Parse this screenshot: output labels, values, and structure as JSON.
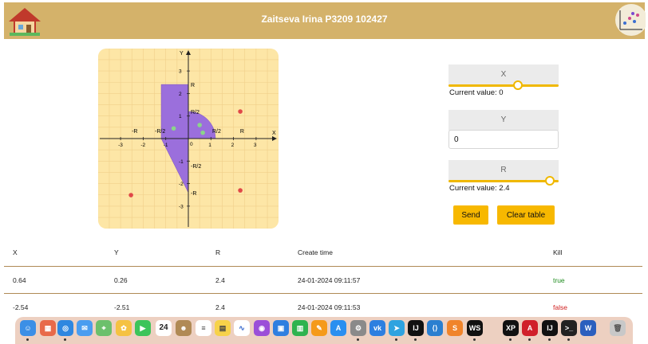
{
  "header": {
    "title": "Zaitseva Irina P3209 102427"
  },
  "graph": {
    "axis_x_label": "X",
    "axis_y_label": "Y",
    "x_ticks": [
      "-3",
      "-2",
      "-1",
      "0",
      "1",
      "2",
      "3"
    ],
    "y_ticks": [
      "3",
      "2",
      "1",
      "-1",
      "-2",
      "-3"
    ],
    "r_labels": {
      "r": "R",
      "half_r": "R/2",
      "neg_half_r": "-R/2",
      "neg_r": "-R"
    },
    "points": [
      {
        "x": 2.3,
        "y": 1.2,
        "hit": false
      },
      {
        "x": 0.5,
        "y": 0.6,
        "hit": true
      },
      {
        "x": -0.65,
        "y": 0.45,
        "hit": true
      },
      {
        "x": 0.64,
        "y": 0.26,
        "hit": true
      },
      {
        "x": -2.54,
        "y": -2.51,
        "hit": false
      },
      {
        "x": 2.3,
        "y": -2.3,
        "hit": false
      }
    ],
    "colors": {
      "area": "#9b6fdc",
      "hit": "#8bd48b",
      "miss": "#e04848",
      "background": "#fde6a6"
    }
  },
  "controls": {
    "x": {
      "label": "X",
      "current_label": "Current value: 0",
      "fraction": 0.63
    },
    "y": {
      "label": "Y",
      "value": "0"
    },
    "r": {
      "label": "R",
      "current_label": "Current value: 2.4",
      "fraction": 0.92
    },
    "send_label": "Send",
    "clear_label": "Clear table"
  },
  "table": {
    "headers": [
      "X",
      "Y",
      "R",
      "Create time",
      "Kill"
    ],
    "rows": [
      [
        "0.64",
        "0.26",
        "2.4",
        "24-01-2024 09:11:57",
        "true"
      ],
      [
        "-2.54",
        "-2.51",
        "2.4",
        "24-01-2024 09:11:53",
        "false"
      ]
    ]
  },
  "dock": {
    "calendar_day": "24",
    "apps": [
      "finder",
      "launchpad",
      "safari",
      "mail",
      "maps",
      "photos",
      "facetime",
      "calendar",
      "contacts",
      "reminders",
      "notes",
      "freeform",
      "podcasts",
      "keynote",
      "numbers",
      "pages",
      "app-store",
      "system-settings",
      "vk",
      "telegram",
      "intellij",
      "vscode",
      "sublime",
      "webstorm",
      "xampp",
      "acrobat",
      "intellij-2",
      "terminal",
      "word",
      "trash"
    ]
  }
}
